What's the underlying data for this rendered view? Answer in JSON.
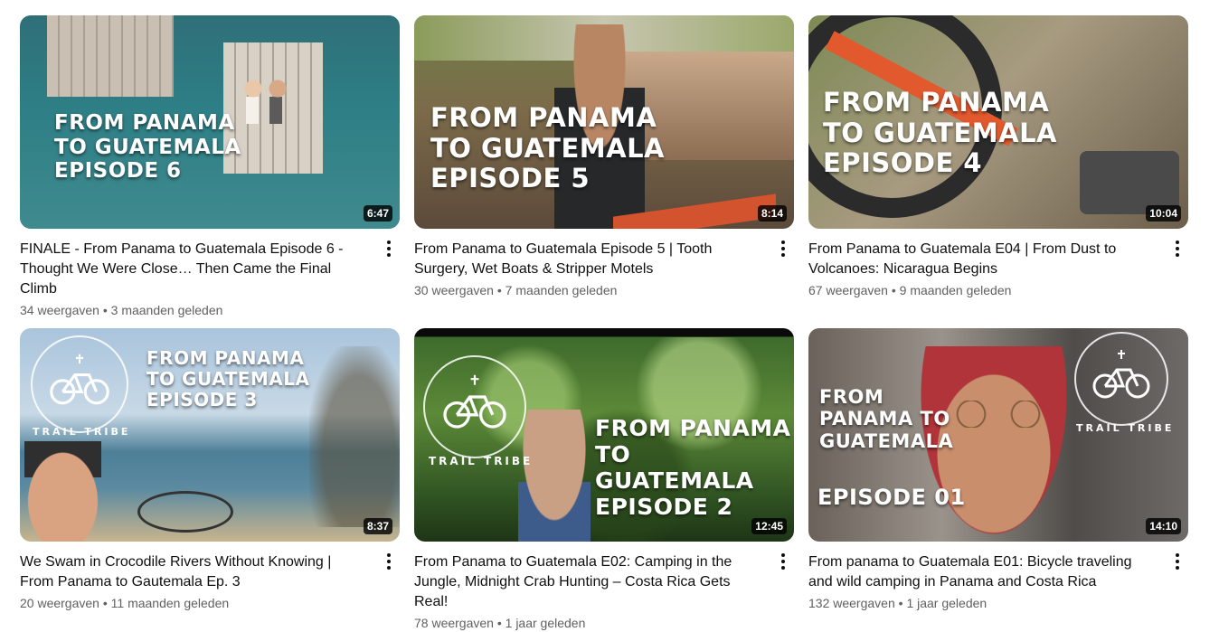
{
  "videos": [
    {
      "title": "FINALE - From Panama to Guatemala Episode 6 - Thought We Were Close… Then Came the Final Climb",
      "views": "34 weergaven",
      "age": "3 maanden geleden",
      "duration": "6:47",
      "thumb_text": "FROM PANAMA\nTO GUATEMALA\nEPISODE 6"
    },
    {
      "title": "From Panama to Guatemala Episode 5 | Tooth Surgery, Wet Boats & Stripper Motels",
      "views": "30 weergaven",
      "age": "7 maanden geleden",
      "duration": "8:14",
      "thumb_text": "FROM PANAMA\nTO GUATEMALA\nEPISODE 5"
    },
    {
      "title": "From Panama to Guatemala E04 | From Dust to Volcanoes: Nicaragua Begins",
      "views": "67 weergaven",
      "age": "9 maanden geleden",
      "duration": "10:04",
      "thumb_text": "FROM PANAMA\nTO GUATEMALA\nEPISODE 4"
    },
    {
      "title": "We Swam in Crocodile Rivers Without Knowing | From Panama to Gautemala Ep. 3",
      "views": "20 weergaven",
      "age": "11 maanden geleden",
      "duration": "8:37",
      "thumb_text": "FROM PANAMA\nTO GUATEMALA\nEPISODE 3",
      "logo_text": "TRAIL TRIBE"
    },
    {
      "title": "From Panama to Guatemala E02: Camping in the Jungle, Midnight Crab Hunting – Costa Rica Gets Real!",
      "views": "78 weergaven",
      "age": "1 jaar geleden",
      "duration": "12:45",
      "thumb_text": "FROM PANAMA\nTO GUATEMALA\nEPISODE 2",
      "logo_text": "TRAIL TRIBE"
    },
    {
      "title": "From panama to Guatemala E01: Bicycle traveling and wild camping in Panama and Costa Rica",
      "views": "132 weergaven",
      "age": "1 jaar geleden",
      "duration": "14:10",
      "thumb_text": "FROM\nPANAMA TO\nGUATEMALA",
      "thumb_text_2": "EPISODE 01",
      "logo_text": "TRAIL TRIBE"
    }
  ],
  "separator": "•",
  "colors": {
    "stats": "#606060",
    "title": "#0f0f0f",
    "duration_bg": "#000000cc"
  }
}
